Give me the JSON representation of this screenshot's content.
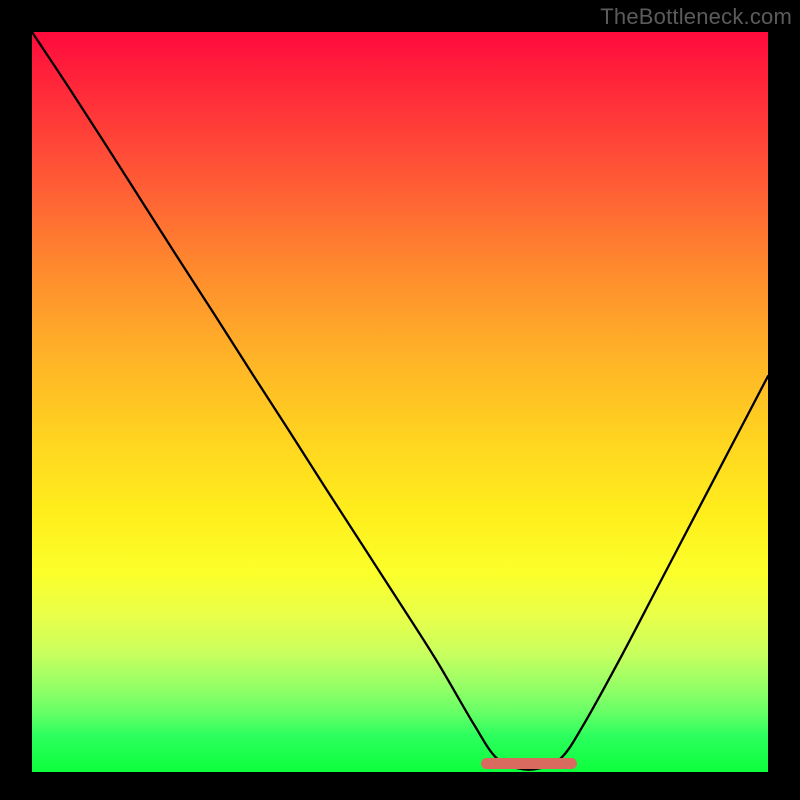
{
  "watermark": "TheBottleneck.com",
  "colors": {
    "frame": "#000000",
    "curve": "#000000",
    "marker": "#d96a5f",
    "watermark_text": "#5b5b5b"
  },
  "chart_data": {
    "type": "line",
    "title": "",
    "xlabel": "",
    "ylabel": "",
    "xlim": [
      0,
      100
    ],
    "ylim": [
      0,
      100
    ],
    "grid": false,
    "legend": false,
    "series": [
      {
        "name": "bottleneck_curve",
        "x": [
          0,
          5,
          10,
          15,
          20,
          25,
          30,
          35,
          40,
          45,
          50,
          55,
          60,
          63,
          66,
          69,
          72,
          75,
          80,
          85,
          90,
          95,
          100
        ],
        "values": [
          100,
          92.5,
          84.8,
          77.0,
          69.2,
          61.5,
          53.7,
          46.0,
          38.2,
          30.5,
          22.8,
          15.0,
          6.5,
          2.0,
          0.5,
          0.5,
          2.0,
          6.5,
          15.5,
          25.0,
          34.5,
          44.0,
          53.5
        ]
      }
    ],
    "annotations": [
      {
        "name": "optimal_range_marker",
        "x_start": 61,
        "x_end": 74,
        "y": 1.2
      }
    ],
    "background_gradient": {
      "stops": [
        {
          "pos": 0,
          "color": "#ff0b3c"
        },
        {
          "pos": 8,
          "color": "#ff2a3a"
        },
        {
          "pos": 20,
          "color": "#ff5a36"
        },
        {
          "pos": 32,
          "color": "#ff8a2e"
        },
        {
          "pos": 44,
          "color": "#ffb327"
        },
        {
          "pos": 55,
          "color": "#ffd420"
        },
        {
          "pos": 65,
          "color": "#ffee1c"
        },
        {
          "pos": 73,
          "color": "#fbff2a"
        },
        {
          "pos": 79,
          "color": "#e8ff4a"
        },
        {
          "pos": 84,
          "color": "#c8ff5e"
        },
        {
          "pos": 88,
          "color": "#9bff66"
        },
        {
          "pos": 92,
          "color": "#66ff66"
        },
        {
          "pos": 95,
          "color": "#2dff5e"
        },
        {
          "pos": 100,
          "color": "#0cff3c"
        }
      ]
    }
  }
}
